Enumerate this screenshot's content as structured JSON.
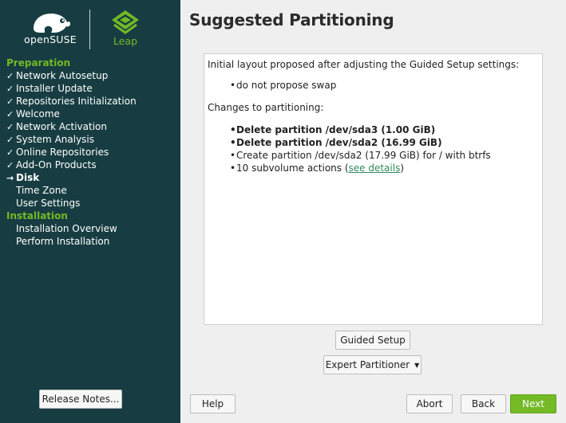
{
  "brand": {
    "opensuse_text": "openSUSE",
    "leap_text": "Leap",
    "colors": {
      "sidebar_bg": "#173d42",
      "accent_green": "#73ba25",
      "link": "#2f8a5c"
    }
  },
  "sidebar": {
    "sections": [
      {
        "heading": "Preparation",
        "steps": [
          {
            "label": "Network Autosetup",
            "mark": "✓"
          },
          {
            "label": "Installer Update",
            "mark": "✓"
          },
          {
            "label": "Repositories Initialization",
            "mark": "✓"
          },
          {
            "label": "Welcome",
            "mark": "✓"
          },
          {
            "label": "Network Activation",
            "mark": "✓"
          },
          {
            "label": "System Analysis",
            "mark": "✓"
          },
          {
            "label": "Online Repositories",
            "mark": "✓"
          },
          {
            "label": "Add-On Products",
            "mark": "✓"
          },
          {
            "label": "Disk",
            "mark": "→"
          },
          {
            "label": "Time Zone",
            "mark": ""
          },
          {
            "label": "User Settings",
            "mark": ""
          }
        ]
      },
      {
        "heading": "Installation",
        "steps": [
          {
            "label": "Installation Overview",
            "mark": ""
          },
          {
            "label": "Perform Installation",
            "mark": ""
          }
        ]
      }
    ],
    "release_notes_label": "Release Notes..."
  },
  "main": {
    "title": "Suggested Partitioning",
    "intro": "Initial layout proposed after adjusting the Guided Setup settings:",
    "intro_items": [
      "do not propose swap"
    ],
    "changes_heading": "Changes to partitioning:",
    "changes": [
      {
        "text": "Delete partition /dev/sda3 (1.00 GiB)"
      },
      {
        "text": "Delete partition /dev/sda2 (16.99 GiB)"
      },
      {
        "text": "Create partition /dev/sda2 (17.99 GiB) for / with btrfs"
      }
    ],
    "subvolume_prefix": "10 subvolume actions (",
    "subvolume_link": "see details",
    "subvolume_suffix": ")",
    "guided_setup_label": "Guided Setup",
    "expert_partitioner_label": "Expert Partitioner"
  },
  "footer": {
    "help_label": "Help",
    "abort_label": "Abort",
    "back_label": "Back",
    "next_label": "Next"
  }
}
